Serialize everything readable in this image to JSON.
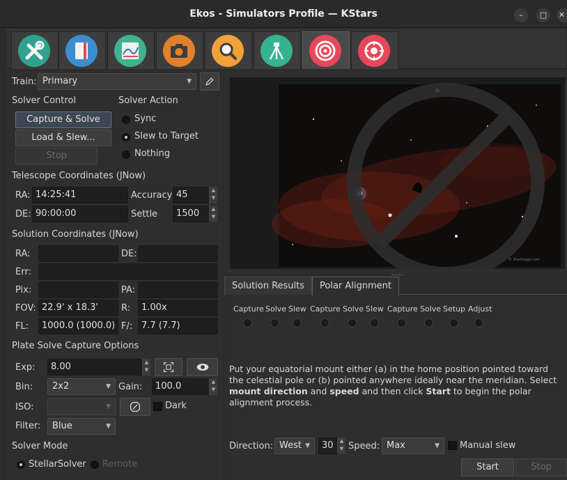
{
  "window": {
    "title": "Ekos - Simulators Profile — KStars",
    "min": "–",
    "max": "□",
    "close": "✕"
  },
  "modules": [
    {
      "name": "setup-icon",
      "color": "#2fa38e"
    },
    {
      "name": "scheduler-icon",
      "color": "#3b8ecf"
    },
    {
      "name": "analyze-icon",
      "color": "#3fb28f"
    },
    {
      "name": "camera-icon",
      "color": "#e3812b"
    },
    {
      "name": "focus-icon",
      "color": "#f0a23a"
    },
    {
      "name": "mount-icon",
      "color": "#35b38f"
    },
    {
      "name": "align-icon",
      "color": "#e8475a"
    },
    {
      "name": "guide-icon",
      "color": "#e8475a"
    }
  ],
  "train": {
    "label": "Train:",
    "value": "Primary"
  },
  "solver_control": {
    "title": "Solver Control",
    "capture_solve": "Capture & Solve",
    "load_slew": "Load & Slew...",
    "stop": "Stop"
  },
  "solver_action": {
    "title": "Solver Action",
    "sync": "Sync",
    "slew": "Slew to Target",
    "nothing": "Nothing"
  },
  "telescope": {
    "title": "Telescope Coordinates (JNow)",
    "ra_label": "RA:",
    "ra": "14:25:41",
    "de_label": "DE:",
    "de": "90:00:00",
    "accuracy_label": "Accuracy",
    "accuracy": "45",
    "settle_label": "Settle",
    "settle": "1500"
  },
  "solution": {
    "title": "Solution Coordinates (JNow)",
    "ra_label": "RA:",
    "de_label": "DE:",
    "err_label": "Err:",
    "pix_label": "Pix:",
    "pa_label": "PA:",
    "fov_label": "FOV:",
    "fov": "22.9' x 18.3'",
    "r_label": "R:",
    "r": "1.00x",
    "fl_label": "FL:",
    "fl": "1000.0 (1000.0)",
    "f_label": "F/:",
    "f": "7.7 (7.7)"
  },
  "capture_opts": {
    "title": "Plate Solve Capture Options",
    "exp_label": "Exp:",
    "exp": "8.00",
    "bin_label": "Bin:",
    "bin": "2x2",
    "gain_label": "Gain:",
    "gain": "100.0",
    "iso_label": "ISO:",
    "dark_label": "Dark",
    "filter_label": "Filter:",
    "filter": "Blue"
  },
  "solver_mode": {
    "title": "Solver Mode",
    "stellar": "StellarSolver",
    "remote": "Remote"
  },
  "image": {
    "watermark": "© Starimage.com"
  },
  "tabs": {
    "results": "Solution Results",
    "polar": "Polar Alignment"
  },
  "polar": {
    "steps": [
      "Capture",
      "Solve",
      "Slew",
      "Capture",
      "Solve",
      "Slew",
      "Capture",
      "Solve",
      "Setup",
      "Adjust"
    ],
    "instr_1": "Put your equatorial mount either (a) in the home position pointed toward the celestial pole or (b) pointed anywhere ideally near the meridian. Select",
    "instr_b1": "mount direction",
    "instr_2": "and",
    "instr_b2": "speed",
    "instr_3": "and then click",
    "instr_b3": "Start",
    "instr_4": "to begin the polar alignment process.",
    "direction_label": "Direction:",
    "direction": "West",
    "deg": "30",
    "speed_label": "Speed:",
    "speed": "Max",
    "manual_label": "Manual slew",
    "start": "Start",
    "stop": "Stop"
  },
  "colors": {
    "accent": "#61798f",
    "nebula": "#7a2418"
  }
}
